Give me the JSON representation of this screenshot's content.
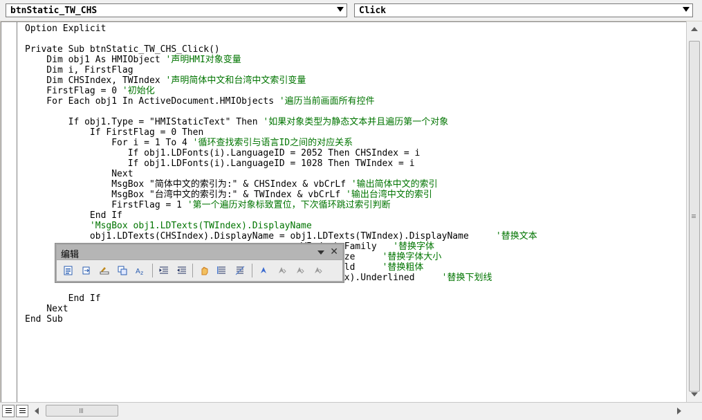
{
  "object_combo": {
    "value": "btnStatic_TW_CHS"
  },
  "event_combo": {
    "value": "Click"
  },
  "code_lines": [
    {
      "code": "Option Explicit",
      "comment": ""
    },
    {
      "code": "",
      "comment": ""
    },
    {
      "code": "Private Sub btnStatic_TW_CHS_Click()",
      "comment": ""
    },
    {
      "code": "    Dim obj1 As HMIObject ",
      "comment": "'声明HMI对象变量"
    },
    {
      "code": "    Dim i, FirstFlag",
      "comment": ""
    },
    {
      "code": "    Dim CHSIndex, TWIndex ",
      "comment": "'声明简体中文和台湾中文索引变量"
    },
    {
      "code": "    FirstFlag = 0 ",
      "comment": "'初始化"
    },
    {
      "code": "    For Each obj1 In ActiveDocument.HMIObjects ",
      "comment": "'遍历当前画面所有控件"
    },
    {
      "code": "",
      "comment": ""
    },
    {
      "code": "        If obj1.Type = \"HMIStaticText\" Then ",
      "comment": "'如果对象类型为静态文本并且遍历第一个对象"
    },
    {
      "code": "            If FirstFlag = 0 Then",
      "comment": ""
    },
    {
      "code": "                For i = 1 To 4 ",
      "comment": "'循环查找索引与语言ID之间的对应关系"
    },
    {
      "code": "                   If obj1.LDFonts(i).LanguageID = 2052 Then CHSIndex = i",
      "comment": ""
    },
    {
      "code": "                   If obj1.LDFonts(i).LanguageID = 1028 Then TWIndex = i",
      "comment": ""
    },
    {
      "code": "                Next",
      "comment": ""
    },
    {
      "code": "                MsgBox \"简体中文的索引为:\" & CHSIndex & vbCrLf ",
      "comment": "'输出简体中文的索引"
    },
    {
      "code": "                MsgBox \"台湾中文的索引为:\" & TWIndex & vbCrLf ",
      "comment": "'输出台湾中文的索引"
    },
    {
      "code": "                FirstFlag = 1 ",
      "comment": "'第一个遍历对象标致置位，下次循环跳过索引判断"
    },
    {
      "code": "            End If",
      "comment": ""
    },
    {
      "code": "            ",
      "comment": "'MsgBox obj1.LDTexts(TWIndex).DisplayName"
    },
    {
      "code": "            obj1.LDTexts(CHSIndex).DisplayName = obj1.LDTexts(TWIndex).DisplayName     ",
      "comment": "'替换文本"
    },
    {
      "code": "                                                   WIndex).Family   ",
      "comment": "'替换字体"
    },
    {
      "code": "                                                   ndex).Size     ",
      "comment": "'替换字体大小"
    },
    {
      "code": "                                                   ndex).Bold     ",
      "comment": "'替换粗体"
    },
    {
      "code": "                                                  ts(TWIndex).Underlined     ",
      "comment": "'替换下划线"
    },
    {
      "code": "",
      "comment": ""
    },
    {
      "code": "        End If",
      "comment": ""
    },
    {
      "code": "    Next",
      "comment": ""
    },
    {
      "code": "End Sub",
      "comment": ""
    }
  ],
  "edit_toolbar": {
    "title": "编辑",
    "buttons": [
      {
        "name": "list-properties-methods",
        "icon": "list-properties-icon",
        "color": "#2a5db0"
      },
      {
        "name": "list-constants",
        "icon": "list-constants-icon",
        "color": "#2a5db0"
      },
      {
        "name": "quick-info",
        "icon": "quick-info-icon",
        "color": "#c08a20"
      },
      {
        "name": "parameter-info",
        "icon": "parameter-info-icon",
        "color": "#2a5db0"
      },
      {
        "name": "complete-word",
        "icon": "complete-word-icon",
        "color": "#2a5db0"
      },
      {
        "name": "indent",
        "icon": "indent-icon",
        "color": "#203060"
      },
      {
        "name": "outdent",
        "icon": "outdent-icon",
        "color": "#203060"
      },
      {
        "name": "toggle-breakpoint",
        "icon": "hand-icon",
        "color": "#d08020"
      },
      {
        "name": "comment-block",
        "icon": "comment-block-icon",
        "color": "#203060"
      },
      {
        "name": "uncomment-block",
        "icon": "uncomment-block-icon",
        "color": "#203060"
      },
      {
        "name": "toggle-bookmark",
        "icon": "bookmark-icon",
        "color": "#3a6ad0"
      },
      {
        "name": "next-bookmark",
        "icon": "next-bookmark-icon",
        "color": "#9a9a9a"
      },
      {
        "name": "previous-bookmark",
        "icon": "previous-bookmark-icon",
        "color": "#9a9a9a"
      },
      {
        "name": "clear-all-bookmarks",
        "icon": "clear-bookmarks-icon",
        "color": "#9a9a9a"
      }
    ]
  }
}
